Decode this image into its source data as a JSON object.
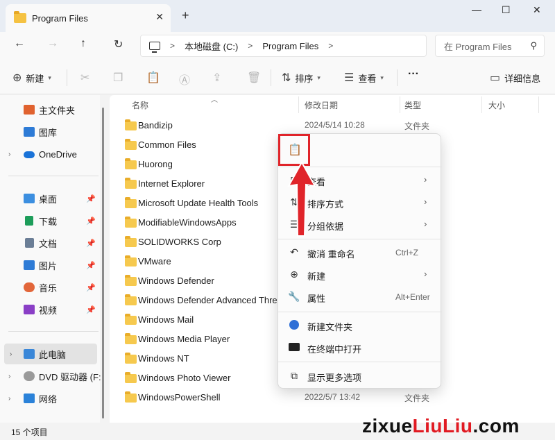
{
  "tab": {
    "title": "Program Files",
    "close": "✕"
  },
  "new_tab": "+",
  "window": {
    "minimize": "—",
    "maximize": "☐",
    "close": "✕"
  },
  "nav": {
    "back": "←",
    "forward": "→",
    "up": "↑",
    "refresh": "↻"
  },
  "address": {
    "crumbs": [
      "本地磁盘 (C:)",
      "Program Files"
    ],
    "sep": ">"
  },
  "search": {
    "placeholder": "在 Program Files"
  },
  "toolbar": {
    "new_label": "新建",
    "sort_label": "排序",
    "view_label": "查看",
    "more": "···",
    "details_label": "详细信息"
  },
  "sidebar": {
    "items": [
      {
        "label": "主文件夹",
        "icon": "home-icon",
        "color": "#e0622f"
      },
      {
        "label": "图库",
        "icon": "gallery-icon",
        "color": "#2e7bd6"
      },
      {
        "label": "OneDrive",
        "icon": "cloud-icon",
        "color": "#1a73d8"
      },
      {
        "label": "桌面",
        "icon": "desktop-icon",
        "color": "#3c8fe0"
      },
      {
        "label": "下载",
        "icon": "download-icon",
        "color": "#1d9d5a"
      },
      {
        "label": "文档",
        "icon": "document-icon",
        "color": "#6b7e96"
      },
      {
        "label": "图片",
        "icon": "pictures-icon",
        "color": "#2e7bd6"
      },
      {
        "label": "音乐",
        "icon": "music-icon",
        "color": "#e2663a"
      },
      {
        "label": "视频",
        "icon": "video-icon",
        "color": "#8a3fc6"
      },
      {
        "label": "此电脑",
        "icon": "pc-icon",
        "color": "#3a87d8"
      },
      {
        "label": "DVD 驱动器 (F:",
        "icon": "dvd-icon",
        "color": "#9a9a9a"
      },
      {
        "label": "网络",
        "icon": "network-icon",
        "color": "#2b82d9"
      }
    ]
  },
  "columns": {
    "name": "名称",
    "date": "修改日期",
    "type": "类型",
    "size": "大小"
  },
  "files": [
    {
      "name": "Bandizip",
      "date": "2024/5/14 10:28",
      "type": "文件夹"
    },
    {
      "name": "Common Files",
      "date": "",
      "type": ""
    },
    {
      "name": "Huorong",
      "date": "",
      "type": ""
    },
    {
      "name": "Internet Explorer",
      "date": "",
      "type": ""
    },
    {
      "name": "Microsoft Update Health Tools",
      "date": "",
      "type": ""
    },
    {
      "name": "ModifiableWindowsApps",
      "date": "",
      "type": ""
    },
    {
      "name": "SOLIDWORKS Corp",
      "date": "",
      "type": ""
    },
    {
      "name": "VMware",
      "date": "",
      "type": ""
    },
    {
      "name": "Windows Defender",
      "date": "",
      "type": ""
    },
    {
      "name": "Windows Defender Advanced Threat Protection",
      "date": "",
      "type": ""
    },
    {
      "name": "Windows Mail",
      "date": "",
      "type": ""
    },
    {
      "name": "Windows Media Player",
      "date": "",
      "type": ""
    },
    {
      "name": "Windows NT",
      "date": "",
      "type": ""
    },
    {
      "name": "Windows Photo Viewer",
      "date": "",
      "type": ""
    },
    {
      "name": "WindowsPowerShell",
      "date": "2022/5/7 13:42",
      "type": "文件夹"
    }
  ],
  "status": {
    "count": "15 个项目"
  },
  "context_menu": {
    "view": "查看",
    "sort": "排序方式",
    "group": "分组依据",
    "undo": "撤消 重命名",
    "undo_shortcut": "Ctrl+Z",
    "new": "新建",
    "properties": "属性",
    "properties_shortcut": "Alt+Enter",
    "new_folder": "新建文件夹",
    "open_terminal": "在终端中打开",
    "more_options": "显示更多选项"
  },
  "watermark": {
    "part1": "zixue",
    "part2": "LiuLiu",
    "part3": ".com"
  },
  "colors": {
    "accent": "#2f6fd6",
    "highlight": "#e0242a"
  }
}
